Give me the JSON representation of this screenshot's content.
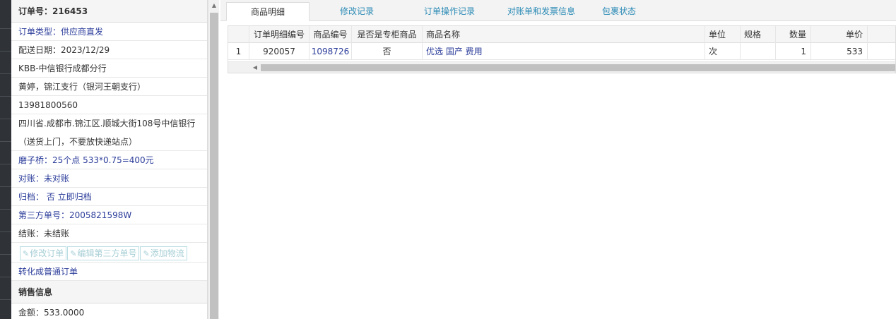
{
  "left_panel": {
    "order_header": "订单号：216453",
    "rows": [
      "订单类型：供应商直发",
      "配送日期：2023/12/29",
      "KBB-中信银行成都分行",
      "黄婷，锦江支行（银河王朝支行）",
      "13981800560",
      "四川省.成都市.锦江区.顺城大街108号中信银行（送货上门，不要放快递站点）",
      "磨子桥：25个点 533*0.75=400元",
      "对账：未对账",
      "归档： 否 立即归档",
      "第三方单号：2005821598W",
      "结账：未结账"
    ],
    "buttons": [
      "修改订单",
      "编辑第三方单号",
      "添加物流"
    ],
    "convert_link": "转化成普通订单",
    "sales_header": "销售信息",
    "amount": "金额：533.0000"
  },
  "tabs": [
    "商品明细",
    "修改记录",
    "订单操作记录",
    "对账单和发票信息",
    "包裹状态"
  ],
  "active_tab": 0,
  "grid": {
    "headers": [
      "",
      "订单明细编号",
      "商品编号",
      "是否是专柜商品",
      "商品名称",
      "单位",
      "规格",
      "数量",
      "单价"
    ],
    "rows": [
      [
        "1",
        "920057",
        "1098726",
        "否",
        "优选 国产 费用",
        "次",
        "",
        "1",
        "533"
      ]
    ]
  },
  "colors": {
    "blue_text": "#2b3c9a",
    "tab_blue": "#2a8ab5",
    "disabled_btn": "#a7cfd6"
  },
  "icons": {
    "edit_button": "edit-icon"
  }
}
